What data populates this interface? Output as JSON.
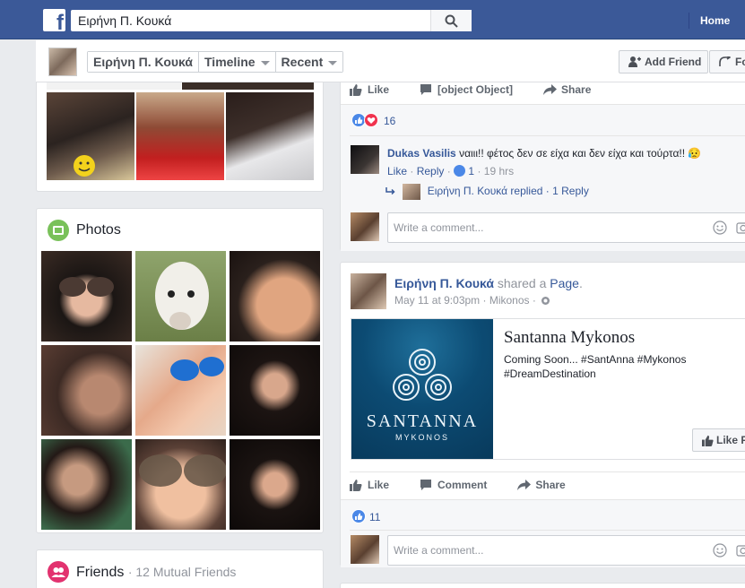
{
  "topbar": {
    "search_value": "Ειρήνη Π. Κουκά",
    "home_label": "Home",
    "brand_color": "#3b5998"
  },
  "timeline_header": {
    "name": "Ειρήνη Π. Κουκά",
    "tab_timeline": "Timeline",
    "tab_recent": "Recent",
    "add_friend": "Add Friend",
    "follow_partial": "Fo"
  },
  "photos_card": {
    "title": "Photos"
  },
  "friends_card": {
    "title": "Friends",
    "subtitle": "· 12 Mutual Friends"
  },
  "post1": {
    "like": "Like",
    "comment": {
      "author": "Dukas Vasilis",
      "text": "ναιιι!! φέτος δεν σε είχα και δεν είχα και τούρτα!! 😥",
      "like": "Like",
      "reply": "Reply",
      "likes": "1",
      "time": "· 19 hrs",
      "dot": "·"
    },
    "share": "Share",
    "reaction_count": "16",
    "reply_summary": {
      "author_replied": "Ειρήνη Π. Κουκά replied",
      "count": "· 1 Reply"
    },
    "write_placeholder": "Write a comment..."
  },
  "post2": {
    "author": "Ειρήνη Π. Κουκά",
    "shared_text": "shared a",
    "page_word": "Page",
    "period": ".",
    "meta": "May 11 at 9:03pm · Mikonos ·",
    "shared_page": {
      "name": "Santanna Mykonos",
      "description": "Coming Soon... #SantAnna #Mykonos #DreamDestination",
      "logo_title": "SANTANNA",
      "logo_sub": "MYKONOS",
      "like_page": "Like P"
    },
    "like": "Like",
    "comment": "Comment",
    "share": "Share",
    "reaction_count": "11",
    "write_placeholder": "Write a comment..."
  }
}
